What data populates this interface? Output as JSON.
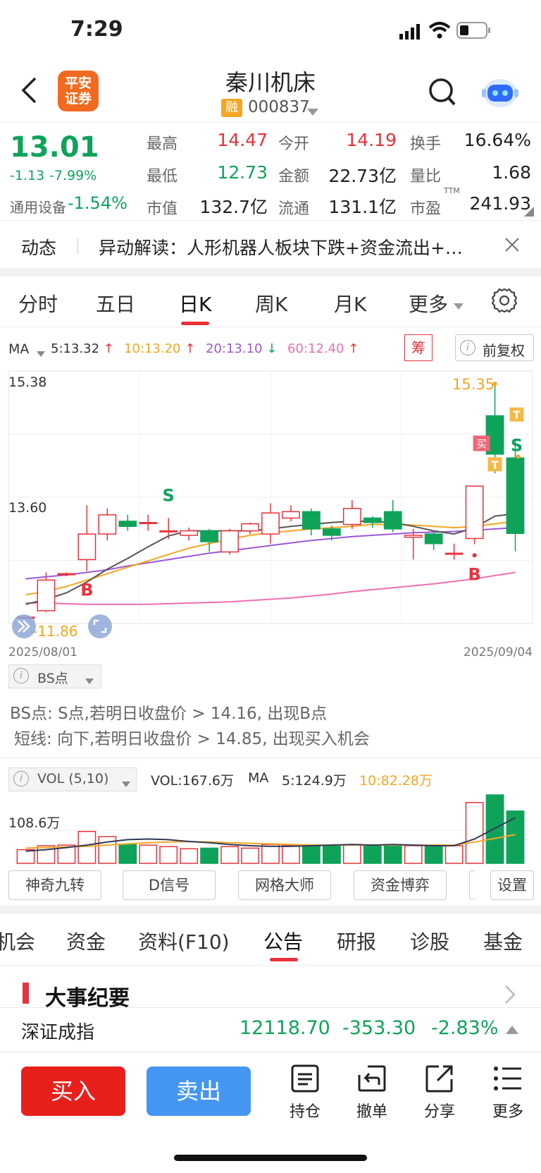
{
  "status_bar": {
    "time": "7:29"
  },
  "header": {
    "broker_logo_text": "平安证券",
    "stock_name": "秦川机床",
    "badge": "融",
    "stock_code": "000837"
  },
  "quote": {
    "price": "13.01",
    "change": "-1.13",
    "change_pct": "-7.99%",
    "sector_name": "通用设备",
    "sector_change": "-1.54%",
    "stats": [
      {
        "label": "最高",
        "value": "14.47"
      },
      {
        "label": "今开",
        "value": "14.19"
      },
      {
        "label": "换手",
        "value": "16.64%"
      },
      {
        "label": "最低",
        "value": "12.73"
      },
      {
        "label": "金额",
        "value": "22.73亿"
      },
      {
        "label": "量比",
        "value": "1.68"
      },
      {
        "label": "市值",
        "value": "132.7亿"
      },
      {
        "label": "流通",
        "value": "131.1亿"
      },
      {
        "label": "市盈",
        "value": "241.93"
      }
    ],
    "ttm": "TTM"
  },
  "news": {
    "label": "动态",
    "text": "异动解读：人形机器人板块下跌+资金流出+…"
  },
  "period_tabs": [
    "分时",
    "五日",
    "日K",
    "周K",
    "月K",
    "更多"
  ],
  "ma_legend": {
    "label": "MA",
    "ma5": "5:13.32",
    "ma10": "10:13.20",
    "ma20": "20:13.10",
    "ma60": "60:12.40",
    "chip_button": "筹",
    "adjust_button": "前复权"
  },
  "kchart": {
    "y_high_label": "15.38",
    "y_mid_label": "13.60",
    "low_label": "11.86",
    "max_label": "15.35",
    "date_start": "2025/08/01",
    "date_end": "2025/09/04",
    "signal_s": "S",
    "signal_b": "B",
    "signal_t": "T",
    "signal_buy": "买"
  },
  "chart_data": {
    "type": "candlestick",
    "ylim": [
      11.6,
      15.55
    ],
    "candles": [
      {
        "o": 11.7,
        "c": 11.7,
        "h": 11.7,
        "l": 11.7
      },
      {
        "o": 11.8,
        "c": 12.28,
        "h": 12.4,
        "l": 11.78
      },
      {
        "o": 12.38,
        "c": 12.38,
        "h": 12.4,
        "l": 12.34
      },
      {
        "o": 12.6,
        "c": 13.0,
        "h": 13.45,
        "l": 12.42
      },
      {
        "o": 13.0,
        "c": 13.3,
        "h": 13.4,
        "l": 12.9
      },
      {
        "o": 13.2,
        "c": 13.12,
        "h": 13.3,
        "l": 13.05
      },
      {
        "o": 13.18,
        "c": 13.18,
        "h": 13.3,
        "l": 13.05
      },
      {
        "o": 13.05,
        "c": 13.05,
        "h": 13.25,
        "l": 12.92
      },
      {
        "o": 12.98,
        "c": 13.05,
        "h": 13.1,
        "l": 12.9
      },
      {
        "o": 13.05,
        "c": 12.88,
        "h": 13.08,
        "l": 12.72
      },
      {
        "o": 12.72,
        "c": 13.05,
        "h": 13.08,
        "l": 12.68
      },
      {
        "o": 13.05,
        "c": 13.16,
        "h": 13.18,
        "l": 13.0
      },
      {
        "o": 13.0,
        "c": 13.33,
        "h": 13.48,
        "l": 12.85
      },
      {
        "o": 13.25,
        "c": 13.35,
        "h": 13.45,
        "l": 13.2
      },
      {
        "o": 13.35,
        "c": 13.08,
        "h": 13.4,
        "l": 12.98
      },
      {
        "o": 13.08,
        "c": 12.98,
        "h": 13.13,
        "l": 12.9
      },
      {
        "o": 13.15,
        "c": 13.4,
        "h": 13.53,
        "l": 13.08
      },
      {
        "o": 13.25,
        "c": 13.18,
        "h": 13.28,
        "l": 13.1
      },
      {
        "o": 13.35,
        "c": 13.08,
        "h": 13.53,
        "l": 13.03
      },
      {
        "o": 12.95,
        "c": 12.98,
        "h": 13.08,
        "l": 12.6
      },
      {
        "o": 13.0,
        "c": 12.85,
        "h": 13.05,
        "l": 12.75
      },
      {
        "o": 12.7,
        "c": 12.7,
        "h": 12.85,
        "l": 12.6
      },
      {
        "o": 12.93,
        "c": 13.75,
        "h": 13.75,
        "l": 12.84
      },
      {
        "o": 14.85,
        "c": 14.25,
        "h": 15.35,
        "l": 13.95
      },
      {
        "o": 14.19,
        "c": 13.01,
        "h": 14.47,
        "l": 12.73
      }
    ],
    "ma5": [
      11.9,
      11.98,
      12.08,
      12.25,
      12.45,
      12.62,
      12.8,
      12.97,
      13.05,
      13.05,
      13.05,
      13.05,
      13.08,
      13.12,
      13.15,
      13.18,
      13.2,
      13.2,
      13.18,
      13.12,
      13.05,
      13.0,
      13.1,
      13.28,
      13.32
    ],
    "ma10": [
      12.05,
      12.1,
      12.18,
      12.28,
      12.38,
      12.48,
      12.58,
      12.68,
      12.78,
      12.85,
      12.92,
      12.98,
      13.02,
      13.05,
      13.08,
      13.1,
      13.12,
      13.15,
      13.15,
      13.14,
      13.12,
      13.1,
      13.12,
      13.16,
      13.2
    ],
    "ma20": [
      12.3,
      12.33,
      12.36,
      12.4,
      12.44,
      12.5,
      12.55,
      12.6,
      12.65,
      12.7,
      12.74,
      12.78,
      12.82,
      12.86,
      12.9,
      12.93,
      12.96,
      12.98,
      13.0,
      13.02,
      13.03,
      13.04,
      13.06,
      13.08,
      13.1
    ],
    "ma60": [
      11.92,
      11.92,
      11.91,
      11.9,
      11.9,
      11.9,
      11.9,
      11.91,
      11.92,
      11.93,
      11.94,
      11.96,
      11.98,
      12.0,
      12.03,
      12.06,
      12.1,
      12.13,
      12.16,
      12.19,
      12.22,
      12.26,
      12.3,
      12.35,
      12.4
    ],
    "volume": [
      45,
      58,
      60,
      105,
      88,
      62,
      60,
      55,
      48,
      50,
      55,
      50,
      62,
      60,
      60,
      58,
      62,
      60,
      62,
      58,
      55,
      58,
      200,
      225,
      172
    ],
    "vol_ma5": [
      40,
      45,
      52,
      60,
      70,
      78,
      80,
      78,
      72,
      68,
      62,
      58,
      56,
      56,
      58,
      60,
      62,
      60,
      62,
      60,
      58,
      58,
      80,
      115,
      150
    ],
    "vol_ma10": [
      50,
      52,
      54,
      56,
      60,
      64,
      68,
      70,
      72,
      70,
      68,
      66,
      64,
      62,
      60,
      60,
      60,
      60,
      60,
      60,
      60,
      60,
      70,
      82,
      95
    ]
  },
  "bs_panel": {
    "label": "BS点",
    "line1": "BS点: S点,若明日收盘价 > 14.16, 出现B点",
    "line2": "短线: 向下,若明日收盘价 > 14.85, 出现买入机会"
  },
  "vol_panel": {
    "label": "VOL (5,10)",
    "vol": "VOL:167.6万",
    "ma_label": "MA",
    "ma5": "5:124.9万",
    "ma10": "10:82.28万",
    "axis_label": "108.6万"
  },
  "indicator_buttons": [
    "神奇九转",
    "D信号",
    "网格大师",
    "资金博弈",
    "设置"
  ],
  "content_tabs": [
    "机会",
    "资金",
    "资料(F10)",
    "公告",
    "研报",
    "诊股",
    "基金"
  ],
  "section_title": "大事纪要",
  "index_ticker": {
    "name": "深证成指",
    "value": "12118.70",
    "change": "-353.30",
    "change_pct": "-2.83%"
  },
  "bottom_bar": {
    "buy": "买入",
    "sell": "卖出",
    "items": [
      "持仓",
      "撤单",
      "分享",
      "更多"
    ]
  }
}
